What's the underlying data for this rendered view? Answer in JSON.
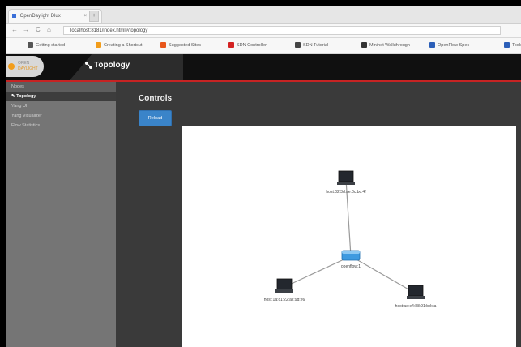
{
  "browser": {
    "tab_title": "OpenDaylight Dlux",
    "tab_close": "×",
    "new_tab": "+",
    "nav": {
      "back": "←",
      "forward": "→",
      "reload": "C",
      "home": "⌂"
    },
    "url": "localhost:8181/index.html#/topology",
    "bookmarks": [
      {
        "label": "Getting started",
        "color": "#555555"
      },
      {
        "label": "Creating a Shortcut",
        "color": "#f29d1b"
      },
      {
        "label": "Suggested Sites",
        "color": "#e8561b"
      },
      {
        "label": "SDN Controller",
        "color": "#d32121"
      },
      {
        "label": "SDN Tutorial",
        "color": "#444444"
      },
      {
        "label": "Mininet Walkthrough",
        "color": "#333333"
      },
      {
        "label": "OpenFlow Spec",
        "color": "#2c5fb8"
      },
      {
        "label": "Tools",
        "color": "#2c5fb8"
      }
    ]
  },
  "app": {
    "logo_line1": "OPEN",
    "logo_line2": "DAYLIGHT",
    "header_icon": "topology-icon",
    "header_title": "Topology"
  },
  "sidebar": {
    "items": [
      {
        "label": "Nodes",
        "active": false
      },
      {
        "label": "Topology",
        "active": true
      },
      {
        "label": "Yang UI",
        "active": false
      },
      {
        "label": "Yang Visualizer",
        "active": false
      },
      {
        "label": "Flow Statistics",
        "active": false
      }
    ]
  },
  "main": {
    "controls_title": "Controls",
    "reload_label": "Reload"
  },
  "topology": {
    "links": [
      {
        "from": "h1",
        "to": "s1"
      },
      {
        "from": "h2",
        "to": "s1"
      },
      {
        "from": "h3",
        "to": "s1"
      }
    ],
    "nodes": [
      {
        "id": "h1",
        "type": "host",
        "label": "host:02:3d:ae:0c:bc:4f"
      },
      {
        "id": "s1",
        "type": "switch",
        "label": "openflow:1"
      },
      {
        "id": "h2",
        "type": "host",
        "label": "host:1a:c1:22:ac:9d:e6"
      },
      {
        "id": "h3",
        "type": "host",
        "label": "host:ae:e4:88:91:bd:ca"
      }
    ]
  }
}
